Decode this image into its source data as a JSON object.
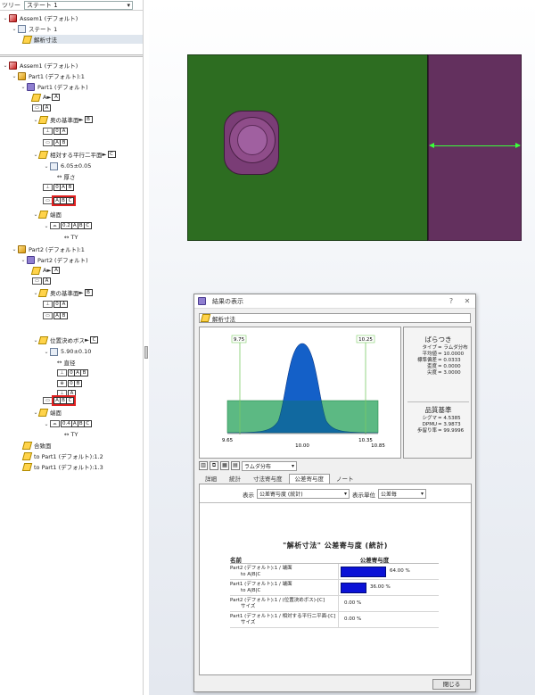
{
  "tree": {
    "header_label": "ツリー",
    "state_value": "ステート 1",
    "top": [
      {
        "label": "Assem1 (デフォルト)"
      },
      {
        "label": "ステート 1"
      },
      {
        "label": "解析寸法"
      }
    ],
    "asm_root": "Assem1 (デフォルト)",
    "part1": {
      "inst": "Part1 (デフォルト):1",
      "name": "Part1 (デフォルト)",
      "datum_a": "A",
      "frame_a": "A",
      "sec_datum": "奥の基準面",
      "sec_datum_tag": "B",
      "frame_b": [
        "0",
        "A"
      ],
      "frame_ab": [
        "A",
        "B"
      ],
      "feature": "相対する平行二平面",
      "feature_tag": "C",
      "size": "6.05±0.05",
      "size_sub": "厚さ",
      "frame_pos": [
        "0",
        "A",
        "B"
      ],
      "drf": [
        "A",
        "B",
        "C"
      ],
      "face": "端面",
      "frame_face": [
        "0.2",
        "A",
        "B",
        "C"
      ],
      "face_sub": "TY"
    },
    "part2": {
      "inst": "Part2 (デフォルト):1",
      "name": "Part2 (デフォルト)",
      "datum_a": "A",
      "frame_a": "A",
      "sec_datum": "奥の基準面",
      "sec_datum_tag": "B",
      "frame_b": [
        "0",
        "A"
      ],
      "frame_ab": [
        "A",
        "B"
      ],
      "feature": "位置決めボス",
      "feature_tag": "C",
      "size": "5.90±0.10",
      "size_sub": "直径",
      "frame_pos": [
        "0",
        "A",
        "B"
      ],
      "frame_pos2": [
        "0",
        "B"
      ],
      "frame_pos3": [
        "A"
      ],
      "drf": [
        "A",
        "B",
        "C"
      ],
      "face": "端面",
      "frame_face": [
        "0.4",
        "A",
        "B",
        "C"
      ],
      "face_sub": "TY"
    },
    "bottom": [
      {
        "label": "合致面"
      },
      {
        "label": "to Part1 (デフォルト):1.2"
      },
      {
        "label": "to Part1 (デフォルト):1.3"
      }
    ]
  },
  "dialog": {
    "title": "結果の表示",
    "help": "?",
    "close_x": "✕",
    "analysis_name": "解析寸法",
    "chart": {
      "lsl_label": "9.75",
      "usl_label": "10.25",
      "axis_left": "9.65",
      "axis_center": "10.00",
      "axis_right": "10.35",
      "axis_right2": "10.85"
    },
    "stats": {
      "title": "ばらつき",
      "rows": [
        {
          "k": "タイプ",
          "v": "= ラムダ分布"
        },
        {
          "k": "平均値",
          "v": "= 10.0000"
        },
        {
          "k": "標準偏差",
          "v": "= 0.0333"
        },
        {
          "k": "歪度",
          "v": "= 0.0000"
        },
        {
          "k": "尖度",
          "v": "= 3.0000"
        }
      ],
      "quality_title": "品質基準",
      "quality_rows": [
        {
          "k": "シグマ",
          "v": "= 4.5385"
        },
        {
          "k": "DPMU",
          "v": "= 3.9873"
        },
        {
          "k": "歩留り率",
          "v": "= 99.9996"
        }
      ]
    },
    "distribution_select": "ラムダ分布",
    "tabs": [
      "詳細",
      "統計",
      "寸法寄与度",
      "公差寄与度",
      "ノート"
    ],
    "active_tab_index": 3,
    "display_label": "表示",
    "display_select": "公差寄与度 (統計)",
    "unit_label": "表示単位",
    "unit_select": "公差毎",
    "report_title": "\"解析寸法\" 公差寄与度 (統計)",
    "col_name": "名前",
    "col_contrib": "公差寄与度",
    "rows": [
      {
        "line1": "Part2 (デフォルト):1 / 端面",
        "line2": "to A|B|C",
        "pct": "64.00 %",
        "value": 64.0
      },
      {
        "line1": "Part1 (デフォルト):1 / 端面",
        "line2": "to A|B|C",
        "pct": "36.00 %",
        "value": 36.0
      },
      {
        "line1": "Part2 (デフォルト):1 / (位置決めボス)-[C]",
        "line2": "サイズ",
        "pct": "0.00 %",
        "value": 0.0
      },
      {
        "line1": "Part1 (デフォルト):1 / 相対する平行二平面-[C]",
        "line2": "サイズ",
        "pct": "0.00 %",
        "value": 0.0
      }
    ],
    "close_button": "閉じる"
  },
  "colors": {
    "part_green": "#2d6d21",
    "part_purple": "#63305e",
    "dim_green": "#3aff3a",
    "bell_blue": "#1460c8",
    "band_green": "#5fcf7a",
    "bar_blue": "#0b12d6",
    "highlight_red": "#e02020"
  }
}
